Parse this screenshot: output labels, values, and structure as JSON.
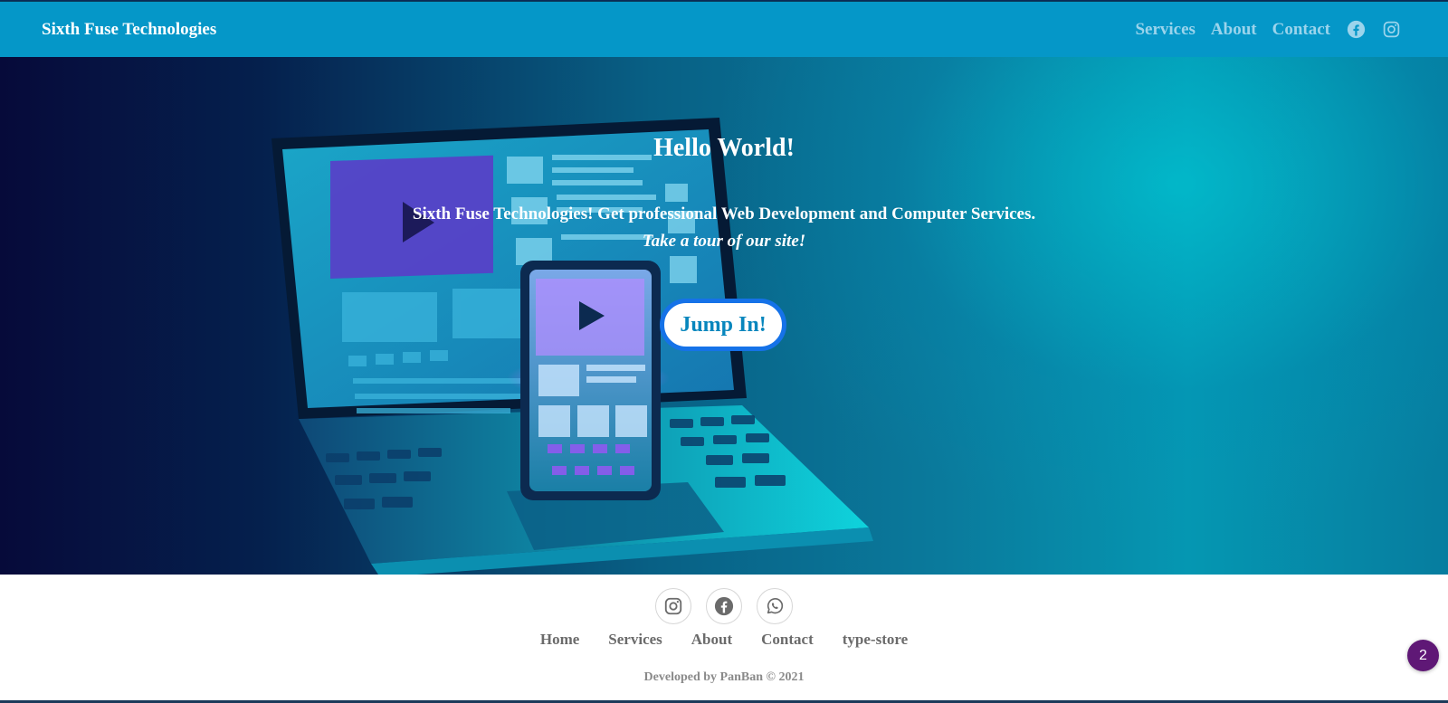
{
  "navbar": {
    "brand": "Sixth Fuse Technologies",
    "links": [
      "Services",
      "About",
      "Contact"
    ],
    "icons": [
      "facebook-icon",
      "instagram-icon"
    ]
  },
  "hero": {
    "title": "Hello World!",
    "subtitle": "Sixth Fuse Technologies! Get professional Web Development and Computer Services.",
    "tagline": "Take a tour of our site!",
    "cta_label": "Jump In!"
  },
  "footer": {
    "social_icons": [
      "instagram-icon",
      "facebook-icon",
      "whatsapp-icon"
    ],
    "links": [
      "Home",
      "Services",
      "About",
      "Contact",
      "type-store"
    ],
    "credit": "Developed by PanBan © 2021"
  },
  "notification_badge": "2",
  "colors": {
    "navbar_bg": "#0597c8",
    "nav_link": "#9bd4ec",
    "cta_border": "#1572e8",
    "cta_text": "#0786bd",
    "badge_bg": "#5f1876"
  }
}
